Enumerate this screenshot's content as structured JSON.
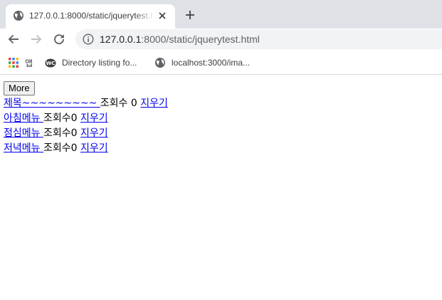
{
  "browser": {
    "tab": {
      "title": "127.0.0.1:8000/static/jquerytest.html",
      "favicon": "globe-icon"
    },
    "address": {
      "host": "127.0.0.1",
      "rest": ":8000/static/jquerytest.html"
    },
    "bookmarks": [
      {
        "label": "앱",
        "icon": "apps-grid-icon"
      },
      {
        "label": "Directory listing fo...",
        "icon": "wc-logo-icon"
      },
      {
        "label": "localhost:3000/ima...",
        "icon": "globe-icon"
      }
    ]
  },
  "page": {
    "more_label": "More",
    "rows": [
      {
        "title": "제목~~~~~~~~~ ",
        "views": "조회수 0 ",
        "delete": "지우기"
      },
      {
        "title": "아침메뉴 ",
        "views": "조회수0 ",
        "delete": "지우기"
      },
      {
        "title": "점심메뉴 ",
        "views": "조회수0 ",
        "delete": "지우기"
      },
      {
        "title": "저녁메뉴 ",
        "views": "조회수0 ",
        "delete": "지우기"
      }
    ]
  },
  "colors": {
    "tabstrip": "#dee1e6",
    "link": "#0000ee",
    "omnibox": "#f1f3f4"
  }
}
